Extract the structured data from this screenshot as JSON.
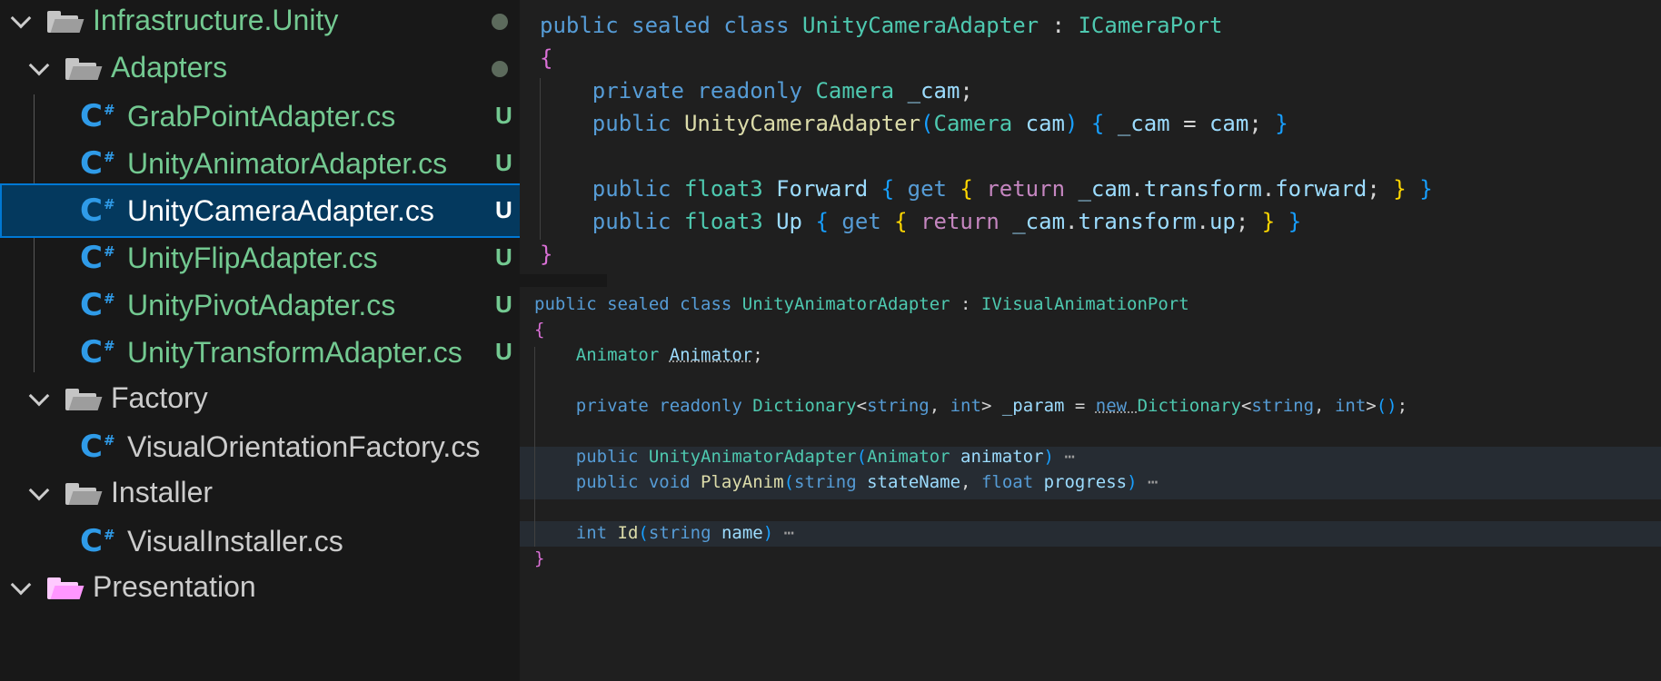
{
  "explorer": {
    "rows": [
      {
        "kind": "folder",
        "label": "Infrastructure.Unity",
        "level": 0,
        "status": "dot"
      },
      {
        "kind": "folder",
        "label": "Adapters",
        "level": 1,
        "status": "dot"
      },
      {
        "kind": "file",
        "label": "GrabPointAdapter.cs",
        "level": 2,
        "status": "U"
      },
      {
        "kind": "file",
        "label": "UnityAnimatorAdapter.cs",
        "level": 2,
        "status": "U"
      },
      {
        "kind": "file",
        "label": "UnityCameraAdapter.cs",
        "level": 2,
        "status": "U",
        "selected": true
      },
      {
        "kind": "file",
        "label": "UnityFlipAdapter.cs",
        "level": 2,
        "status": "U"
      },
      {
        "kind": "file",
        "label": "UnityPivotAdapter.cs",
        "level": 2,
        "status": "U"
      },
      {
        "kind": "file",
        "label": "UnityTransformAdapter.cs",
        "level": 2,
        "status": "U"
      },
      {
        "kind": "folder",
        "label": "Factory",
        "level": 1
      },
      {
        "kind": "file",
        "label": "VisualOrientationFactory.cs",
        "level": 2
      },
      {
        "kind": "folder",
        "label": "Installer",
        "level": 1
      },
      {
        "kind": "file",
        "label": "VisualInstaller.cs",
        "level": 2
      },
      {
        "kind": "folder",
        "label": "Presentation",
        "level": 0,
        "partial": true
      }
    ]
  },
  "code1": {
    "lines": [
      [
        [
          "kw",
          "public "
        ],
        [
          "kw",
          "sealed "
        ],
        [
          "kw",
          "class "
        ],
        [
          "ty",
          "UnityCameraAdapter"
        ],
        [
          "pl",
          " : "
        ],
        [
          "ty",
          "ICameraPort"
        ]
      ],
      [
        [
          "b2",
          "{"
        ]
      ],
      [
        [
          "pl",
          "    "
        ],
        [
          "kw",
          "private "
        ],
        [
          "kw",
          "readonly "
        ],
        [
          "ty",
          "Camera "
        ],
        [
          "va",
          "_cam"
        ],
        [
          "pl",
          ";"
        ]
      ],
      [
        [
          "pl",
          "    "
        ],
        [
          "kw",
          "public "
        ],
        [
          "fn",
          "UnityCameraAdapter"
        ],
        [
          "b3",
          "("
        ],
        [
          "ty",
          "Camera "
        ],
        [
          "va",
          "cam"
        ],
        [
          "b3",
          ")"
        ],
        [
          "pl",
          " "
        ],
        [
          "b3",
          "{"
        ],
        [
          "pl",
          " "
        ],
        [
          "va",
          "_cam"
        ],
        [
          "pl",
          " = "
        ],
        [
          "va",
          "cam"
        ],
        [
          "pl",
          "; "
        ],
        [
          "b3",
          "}"
        ]
      ],
      [],
      [
        [
          "pl",
          "    "
        ],
        [
          "kw",
          "public "
        ],
        [
          "ty",
          "float3 "
        ],
        [
          "va",
          "Forward"
        ],
        [
          "pl",
          " "
        ],
        [
          "b3",
          "{"
        ],
        [
          "pl",
          " "
        ],
        [
          "kw",
          "get "
        ],
        [
          "b1",
          "{"
        ],
        [
          "pl",
          " "
        ],
        [
          "pv",
          "return "
        ],
        [
          "va",
          "_cam"
        ],
        [
          "pl",
          "."
        ],
        [
          "va",
          "transform"
        ],
        [
          "pl",
          "."
        ],
        [
          "va",
          "forward"
        ],
        [
          "pl",
          "; "
        ],
        [
          "b1",
          "}"
        ],
        [
          "pl",
          " "
        ],
        [
          "b3",
          "}"
        ]
      ],
      [
        [
          "pl",
          "    "
        ],
        [
          "kw",
          "public "
        ],
        [
          "ty",
          "float3 "
        ],
        [
          "va",
          "Up"
        ],
        [
          "pl",
          " "
        ],
        [
          "b3",
          "{"
        ],
        [
          "pl",
          " "
        ],
        [
          "kw",
          "get "
        ],
        [
          "b1",
          "{"
        ],
        [
          "pl",
          " "
        ],
        [
          "pv",
          "return "
        ],
        [
          "va",
          "_cam"
        ],
        [
          "pl",
          "."
        ],
        [
          "va",
          "transform"
        ],
        [
          "pl",
          "."
        ],
        [
          "va",
          "up"
        ],
        [
          "pl",
          "; "
        ],
        [
          "b1",
          "}"
        ],
        [
          "pl",
          " "
        ],
        [
          "b3",
          "}"
        ]
      ],
      [
        [
          "b2",
          "}"
        ]
      ]
    ]
  },
  "code2": {
    "lines": [
      [
        [
          "kw",
          "public "
        ],
        [
          "kw",
          "sealed "
        ],
        [
          "kw",
          "class "
        ],
        [
          "ty",
          "UnityAnimatorAdapter"
        ],
        [
          "pl",
          " : "
        ],
        [
          "ty",
          "IVisualAnimationPort"
        ]
      ],
      [
        [
          "b2",
          "{"
        ]
      ],
      [
        [
          "pl",
          "    "
        ],
        [
          "ty",
          "Animator "
        ],
        [
          "va",
          "Animator"
        ],
        [
          "pl",
          ";"
        ]
      ],
      [],
      [
        [
          "pl",
          "    "
        ],
        [
          "kw",
          "private "
        ],
        [
          "kw",
          "readonly "
        ],
        [
          "ty",
          "Dictionary"
        ],
        [
          "pl",
          "<"
        ],
        [
          "kw",
          "string"
        ],
        [
          "pl",
          ", "
        ],
        [
          "kw",
          "int"
        ],
        [
          "pl",
          "> "
        ],
        [
          "va",
          "_param"
        ],
        [
          "pl",
          " = "
        ],
        [
          "kw",
          "new "
        ],
        [
          "ty",
          "Dictionary"
        ],
        [
          "pl",
          "<"
        ],
        [
          "kw",
          "string"
        ],
        [
          "pl",
          ", "
        ],
        [
          "kw",
          "int"
        ],
        [
          "pl",
          ">"
        ],
        [
          "b3",
          "()"
        ],
        [
          "pl",
          ";"
        ]
      ],
      [],
      [
        [
          "pl",
          "    "
        ],
        [
          "kw",
          "public "
        ],
        [
          "ty",
          "UnityAnimatorAdapter"
        ],
        [
          "b3",
          "("
        ],
        [
          "ty",
          "Animator "
        ],
        [
          "va",
          "animator"
        ],
        [
          "b3",
          ")"
        ],
        [
          "ell",
          " ⋯"
        ]
      ],
      [
        [
          "pl",
          "    "
        ],
        [
          "kw",
          "public "
        ],
        [
          "kw",
          "void "
        ],
        [
          "fn",
          "PlayAnim"
        ],
        [
          "b3",
          "("
        ],
        [
          "kw",
          "string "
        ],
        [
          "va",
          "stateName"
        ],
        [
          "pl",
          ", "
        ],
        [
          "kw",
          "float "
        ],
        [
          "va",
          "progress"
        ],
        [
          "b3",
          ")"
        ],
        [
          "ell",
          " ⋯"
        ]
      ],
      [],
      [
        [
          "pl",
          "    "
        ],
        [
          "kw",
          "int "
        ],
        [
          "fn",
          "Id"
        ],
        [
          "b3",
          "("
        ],
        [
          "kw",
          "string "
        ],
        [
          "va",
          "name"
        ],
        [
          "b3",
          ")"
        ],
        [
          "ell",
          " ⋯"
        ]
      ],
      [
        [
          "b2",
          "}"
        ]
      ]
    ]
  }
}
